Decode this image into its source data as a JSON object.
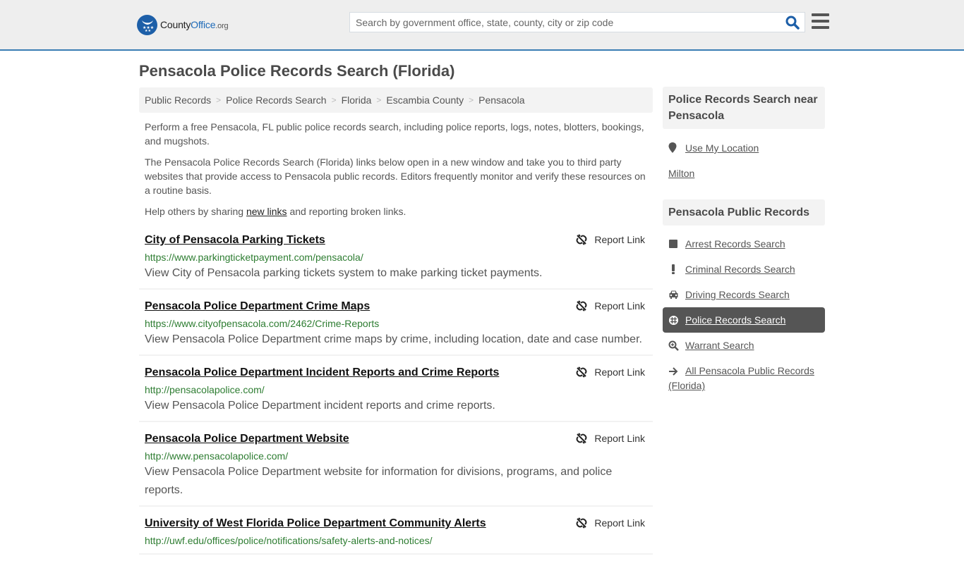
{
  "header": {
    "logo": {
      "part1": "County",
      "part2": "Office",
      "part3": ".org"
    },
    "search": {
      "placeholder": "Search by government office, state, county, city or zip code",
      "value": ""
    },
    "icons": {
      "search": "search-icon",
      "menu": "hamburger-menu-icon"
    },
    "colors": {
      "accent": "#3a7db3",
      "brand": "#1d5fa8"
    }
  },
  "page": {
    "title": "Pensacola Police Records Search (Florida)",
    "breadcrumb": [
      "Public Records",
      "Police Records Search",
      "Florida",
      "Escambia County",
      "Pensacola"
    ],
    "intro": {
      "p1": "Perform a free Pensacola, FL public police records search, including police reports, logs, notes, blotters, bookings, and mugshots.",
      "p2": "The Pensacola Police Records Search (Florida) links below open in a new window and take you to third party websites that provide access to Pensacola public records. Editors frequently monitor and verify these resources on a routine basis.",
      "p3_before": "Help others by sharing ",
      "p3_link": "new links",
      "p3_after": " and reporting broken links."
    }
  },
  "results": [
    {
      "title": "City of Pensacola Parking Tickets",
      "url": "https://www.parkingticketpayment.com/pensacola/",
      "desc": "View City of Pensacola parking tickets system to make parking ticket payments.",
      "report": "Report Link"
    },
    {
      "title": "Pensacola Police Department Crime Maps",
      "url": "https://www.cityofpensacola.com/2462/Crime-Reports",
      "desc": "View Pensacola Police Department crime maps by crime, including location, date and case number.",
      "report": "Report Link"
    },
    {
      "title": "Pensacola Police Department Incident Reports and Crime Reports",
      "url": "http://pensacolapolice.com/",
      "desc": "View Pensacola Police Department incident reports and crime reports.",
      "report": "Report Link"
    },
    {
      "title": "Pensacola Police Department Website",
      "url": "http://www.pensacolapolice.com/",
      "desc": "View Pensacola Police Department website for information for divisions, programs, and police reports.",
      "report": "Report Link"
    },
    {
      "title": "University of West Florida Police Department Community Alerts",
      "url": "http://uwf.edu/offices/police/notifications/safety-alerts-and-notices/",
      "desc": "",
      "report": "Report Link"
    }
  ],
  "sidebar": {
    "nearby": {
      "heading": "Police Records Search near Pensacola",
      "use_location": "Use My Location",
      "places": [
        "Milton"
      ]
    },
    "public_records": {
      "heading": "Pensacola Public Records",
      "items": [
        {
          "label": "Arrest Records Search",
          "icon": "square-icon",
          "active": false
        },
        {
          "label": "Criminal Records Search",
          "icon": "exclamation-icon",
          "active": false
        },
        {
          "label": "Driving Records Search",
          "icon": "car-icon",
          "active": false
        },
        {
          "label": "Police Records Search",
          "icon": "crosshair-icon",
          "active": true
        },
        {
          "label": "Warrant Search",
          "icon": "magnify-plus-icon",
          "active": false
        },
        {
          "label": "All Pensacola Public Records (Florida)",
          "icon": "arrow-right-icon",
          "active": false
        }
      ]
    }
  }
}
